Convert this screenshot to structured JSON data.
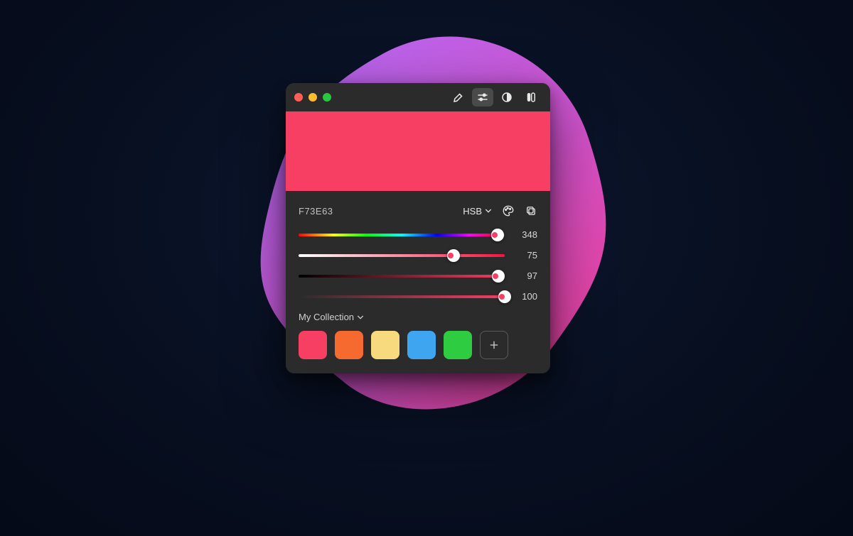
{
  "current_color": {
    "hex": "F73E63",
    "preview_css": "#f73e63"
  },
  "mode": {
    "label": "HSB"
  },
  "sliders": {
    "hue": {
      "value": 348,
      "max": 360,
      "thumb_color": "#f73e63"
    },
    "saturation": {
      "value": 75,
      "max": 100,
      "thumb_color": "#f73e63",
      "gradient_from": "#ffffff",
      "gradient_to": "#f7143f"
    },
    "brightness": {
      "value": 97,
      "max": 100,
      "thumb_color": "#f73e63",
      "gradient_from": "#000000",
      "gradient_to": "#f73e63"
    },
    "alpha": {
      "value": 100,
      "max": 100,
      "thumb_color": "#f73e63",
      "gradient_from": "rgba(247,62,99,0)",
      "gradient_to": "#f73e63"
    }
  },
  "collection": {
    "label": "My Collection",
    "colors": [
      "#f73e63",
      "#f76a2f",
      "#f7d97e",
      "#3ea6f0",
      "#2ecc40"
    ]
  }
}
